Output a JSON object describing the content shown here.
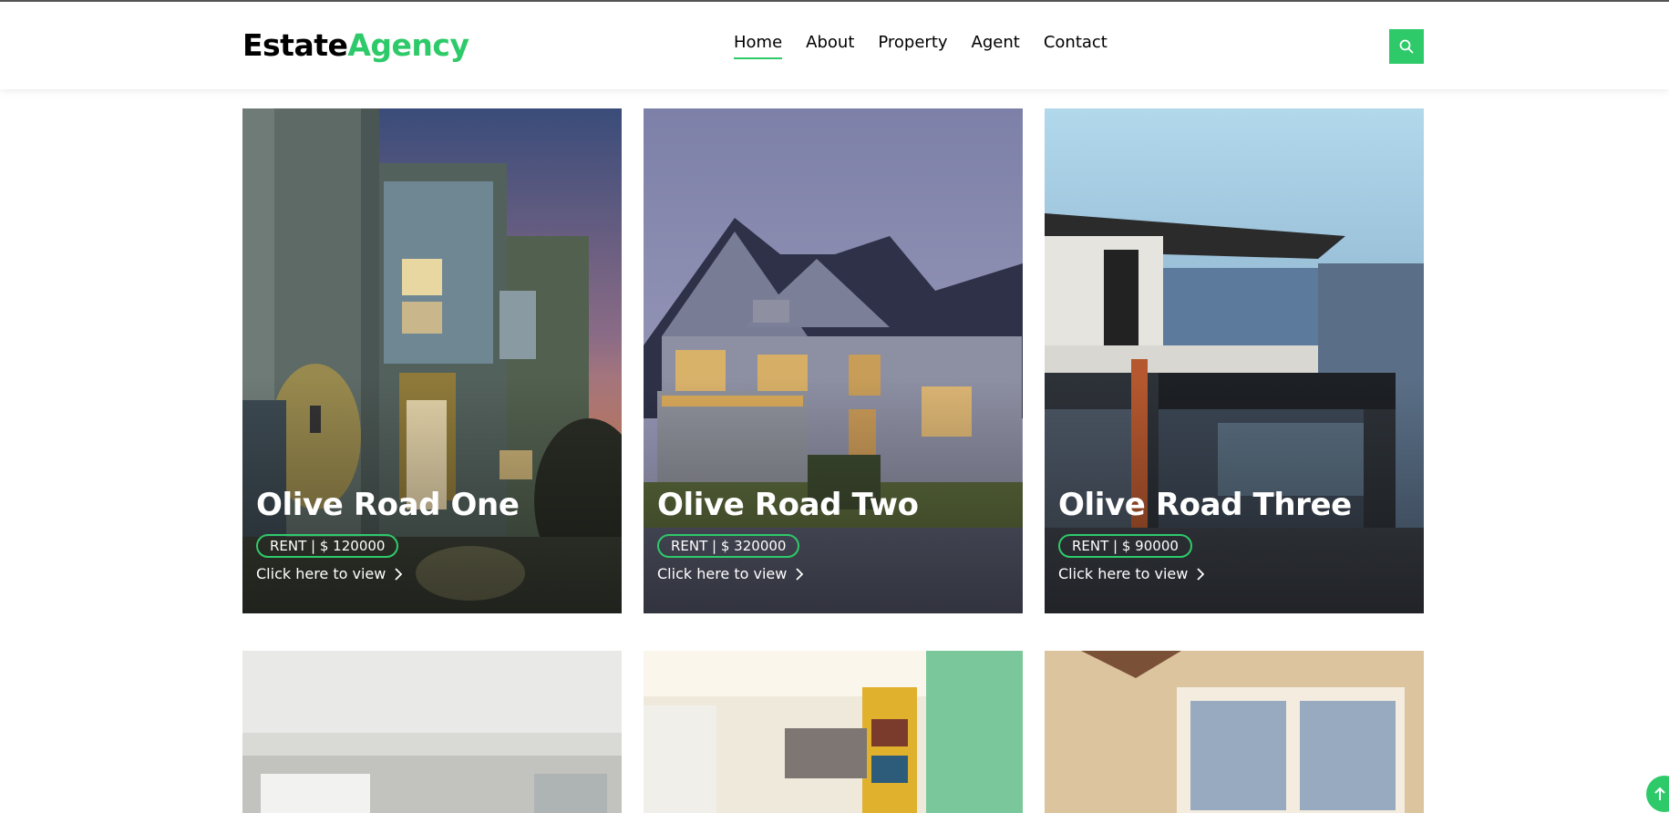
{
  "brand": {
    "part1": "Estate",
    "part2": "Agency"
  },
  "nav": {
    "items": [
      {
        "label": "Home",
        "active": true
      },
      {
        "label": "About"
      },
      {
        "label": "Property"
      },
      {
        "label": "Agent"
      },
      {
        "label": "Contact"
      }
    ]
  },
  "search": {
    "icon": "search-icon"
  },
  "properties": [
    {
      "title": "Olive Road One",
      "price": "RENT | $ 120000",
      "link": "Click here to view"
    },
    {
      "title": "Olive Road Two",
      "price": "RENT | $ 320000",
      "link": "Click here to view"
    },
    {
      "title": "Olive Road Three",
      "price": "RENT | $ 90000",
      "link": "Click here to view"
    }
  ],
  "colors": {
    "accent": "#2eca6a"
  }
}
